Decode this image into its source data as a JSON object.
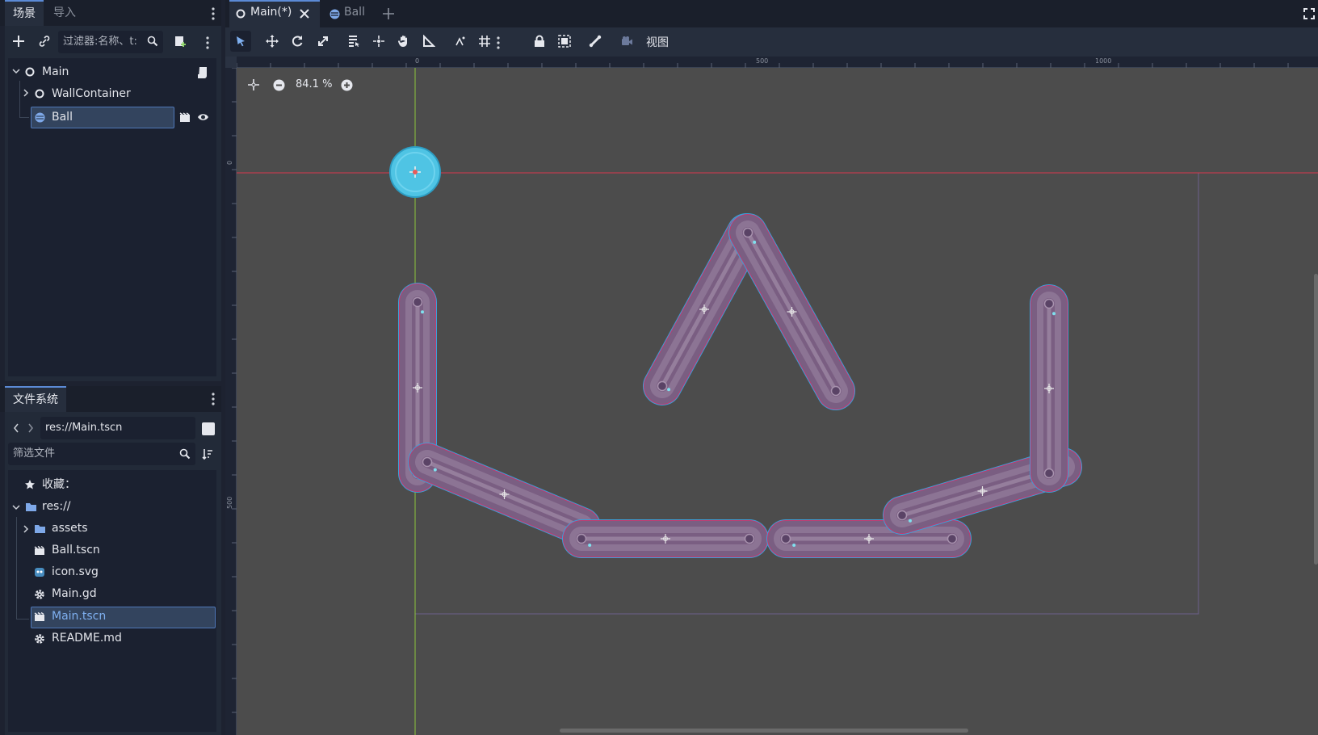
{
  "scene_dock": {
    "tabs": [
      "场景",
      "导入"
    ],
    "filter_placeholder": "过滤器:名称、t:",
    "tree": [
      {
        "label": "Main",
        "icon": "node2d-icon"
      },
      {
        "label": "WallContainer",
        "icon": "node2d-icon"
      },
      {
        "label": "Ball",
        "icon": "rigidbody-icon"
      }
    ]
  },
  "filesystem_dock": {
    "tab": "文件系统",
    "path": "res://Main.tscn",
    "filter_placeholder": "筛选文件",
    "items": [
      {
        "label": "收藏：",
        "icon": "star-icon"
      },
      {
        "label": "res://",
        "icon": "folder-icon"
      },
      {
        "label": "assets",
        "icon": "folder-icon"
      },
      {
        "label": "Ball.tscn",
        "icon": "scene-file-icon"
      },
      {
        "label": "icon.svg",
        "icon": "godot-icon"
      },
      {
        "label": "Main.gd",
        "icon": "gear-icon"
      },
      {
        "label": "Main.tscn",
        "icon": "scene-file-icon"
      },
      {
        "label": "README.md",
        "icon": "gear-icon"
      }
    ]
  },
  "editor_tabs": [
    {
      "label": "Main(*)",
      "icon": "node2d-icon"
    },
    {
      "label": "Ball",
      "icon": "rigidbody-icon"
    }
  ],
  "toolbar": {
    "view_label": "视图"
  },
  "viewport": {
    "zoom": "84.1 %",
    "ruler_h": [
      "0",
      "500",
      "1000"
    ],
    "ruler_v": [
      "0",
      "500"
    ]
  },
  "colors": {
    "accent": "#5b8ad6",
    "wall_fill": "#7a5e82",
    "wall_outline": "#3aa0d8",
    "ball": "#4fc4e4",
    "x_axis": "#d9394e",
    "y_axis": "#8cc43c"
  }
}
